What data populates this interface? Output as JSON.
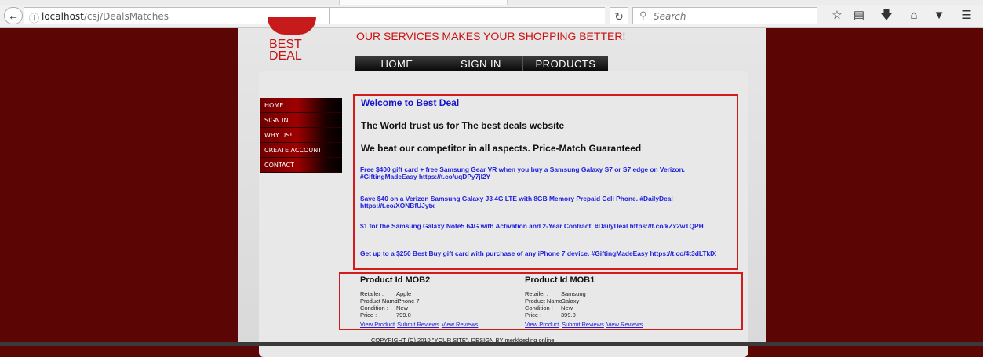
{
  "browser": {
    "url_host": "localhost",
    "url_path": "/csj/DealsMatches",
    "search_placeholder": "Search",
    "icons": [
      "back-arrow-icon",
      "info-icon",
      "reload-icon",
      "search-icon",
      "star-icon",
      "reading-list-icon",
      "download-icon",
      "home-icon",
      "pocket-icon",
      "menu-icon"
    ]
  },
  "brand": {
    "logo_line1": "BEST",
    "logo_line2": "DEAL",
    "slogan": "OUR SERVICES MAKES YOUR SHOPPING BETTER!",
    "accent": "#cc1111",
    "background": "#5c0505"
  },
  "topnav": [
    "HOME",
    "SIGN IN",
    "PRODUCTS"
  ],
  "sidenav": [
    "HOME",
    "SIGN IN",
    "WHY US!",
    "CREATE ACCOUNT",
    "CONTACT"
  ],
  "welcome": {
    "title": "Welcome to Best Deal",
    "line1": "The World trust us for The best deals website",
    "line2": "We beat our competitor in all aspects. Price-Match Guaranteed",
    "deals": [
      "Free $400 gift card + free Samsung Gear VR when you buy a Samsung Galaxy S7 or S7 edge on Verizon. #GiftingMadeEasy https://t.co/uqDPy7jl2Y",
      "Save $40 on a Verizon Samsung Galaxy J3 4G LTE with 8GB Memory Prepaid Cell Phone. #DailyDeal https://t.co/XONBfUJytx",
      "$1 for the Samsung Galaxy Note5 64G with Activation and 2-Year Contract. #DailyDeal https://t.co/kZx2wTQPH",
      "Get up to a $250 Best Buy gift card with purchase of any iPhone 7 device. #GiftingMadeEasy https://t.co/4t3dLTkIX"
    ]
  },
  "labels": {
    "retailer": "Retailer :",
    "product_name": "Product Name :",
    "condition": "Condition :",
    "price": "Price :",
    "view_product": "View Product",
    "submit_reviews": "Submit Reviews",
    "view_reviews": "View Reviews"
  },
  "products": [
    {
      "id": "Product Id MOB2",
      "retailer": "Apple",
      "product_name": "iPhone 7",
      "condition": "New",
      "price": "799.0"
    },
    {
      "id": "Product Id MOB1",
      "retailer": "Samsung",
      "product_name": "Galaxy",
      "condition": "New",
      "price": "399.0"
    }
  ],
  "footer": {
    "copyright": "COPYRIGHT (C) 2010 \"YOUR SITE\". DESIGN BY merkldeding online"
  }
}
